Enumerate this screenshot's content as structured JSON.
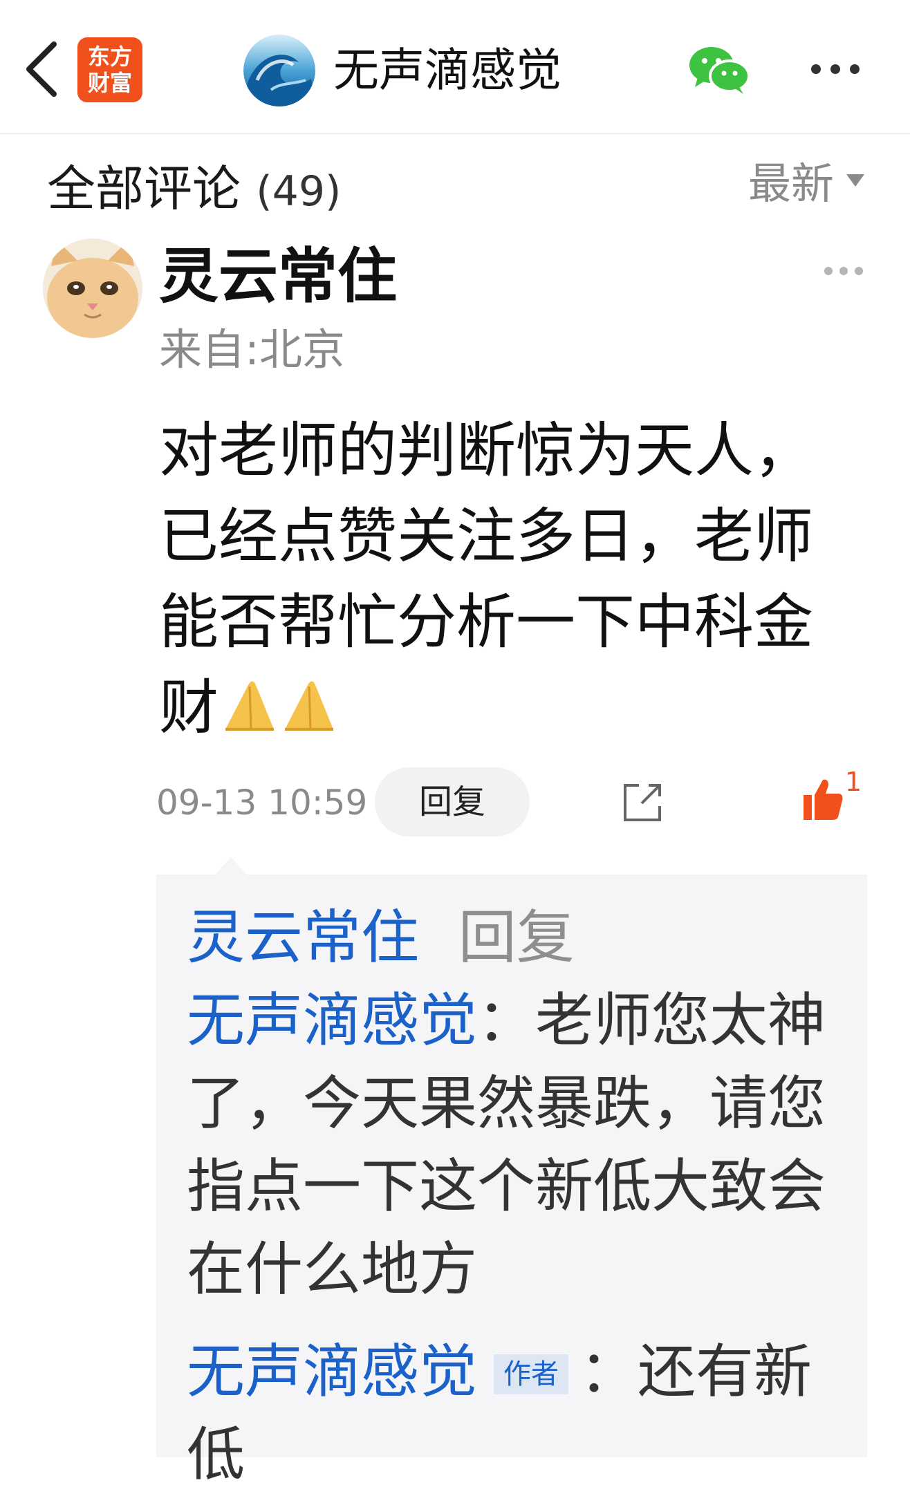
{
  "header": {
    "logo_line1": "东方",
    "logo_line2": "财富",
    "channel_name": "无声滴感觉"
  },
  "comments_header": {
    "title": "全部评论",
    "count": "(49)",
    "sort_label": "最新"
  },
  "comment": {
    "username": "灵云常住",
    "location": "来自:北京",
    "body_lines": [
      "对老师的判断惊为天人，",
      "已经点赞关注多日，老师",
      "能否帮忙分析一下中科金",
      "财"
    ],
    "timestamp": "09-13 10:59",
    "reply_button": "回复",
    "like_count": "1"
  },
  "replies": {
    "header_user": "灵云常住",
    "header_action": "回复",
    "reply1_user": "无声滴感觉",
    "reply1_separator": "：",
    "reply1_lines": [
      "老师您太神",
      "了，今天果然暴跌，请您",
      "指点一下这个新低大致会",
      "在什么地方"
    ],
    "reply2_user": "无声滴感觉",
    "reply2_badge": "作者",
    "reply2_separator": "：",
    "reply2_text": "还有新低"
  },
  "colors": {
    "brand_orange": "#f0501c",
    "link_blue": "#1a62c9",
    "wechat_green": "#3ec241"
  }
}
